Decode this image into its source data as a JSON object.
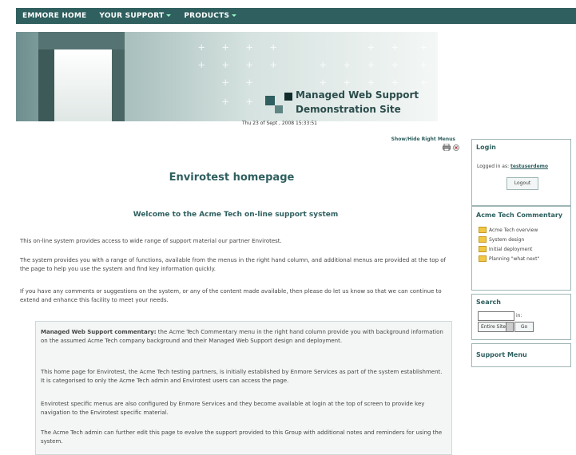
{
  "nav": {
    "home": "EMMORE HOME",
    "support": "YOUR SUPPORT",
    "products": "PRODUCTS"
  },
  "banner": {
    "title_line1": "Managed Web Support",
    "title_line2": "Demonstration Site"
  },
  "date": "Thu 23 of Sept , 2008 15:33:51",
  "show_menu": "Show/Hide Right Menus",
  "main": {
    "title": "Envirotest homepage",
    "welcome": "Welcome to the Acme Tech on-line support system",
    "para1": "This on-line system provides access to wide range of support material our partner Envirotest.",
    "para2": "The system provides you with a range of functions, available from the menus in the right hand column, and additional menus are provided at the top of the page to help you use the system and find key information quickly.",
    "para3": "If you have any comments or suggestions on the system, or any of the content made available, then please do let us know so that we can continue to extend and enhance this facility to meet your needs."
  },
  "commentary": {
    "p1_bold": "Managed Web Support commentary:",
    "p1": " the Acme Tech Commentary menu in the right hand column provide you with background information on the assumed Acme Tech company background and their Managed Web Support design and deployment.",
    "p2": "This home page for Envirotest, the Acme Tech testing partners, is initially established by Enmore Services as part of the system establishment. It is categorised to only the Acme Tech admin and Envirotest users can access the page.",
    "p3": "Envirotest specific menus are also configured by Enmore Services and they become available at login at the top of screen to provide key navigation to the Envirotest specific material.",
    "p4": "The Acme Tech admin can further edit this page to evolve the support provided to this Group with additional notes and reminders for using the system."
  },
  "sidebar": {
    "login": {
      "heading": "Login",
      "logged_in_prefix": "Logged in as: ",
      "username": "testuserdemo",
      "logout_label": "Logout"
    },
    "commentary": {
      "heading": "Acme Tech Commentary",
      "items": [
        "Acme Tech overview",
        "System design",
        "Initial deployment",
        "Planning \"what next\""
      ]
    },
    "search": {
      "heading": "Search",
      "in_label": "in:",
      "select_value": "Entire Site",
      "go_label": "Go"
    },
    "support_menu": {
      "heading": "Support Menu"
    }
  },
  "colors": {
    "brand": "#2f5f5f",
    "folder": "#f2c744"
  }
}
